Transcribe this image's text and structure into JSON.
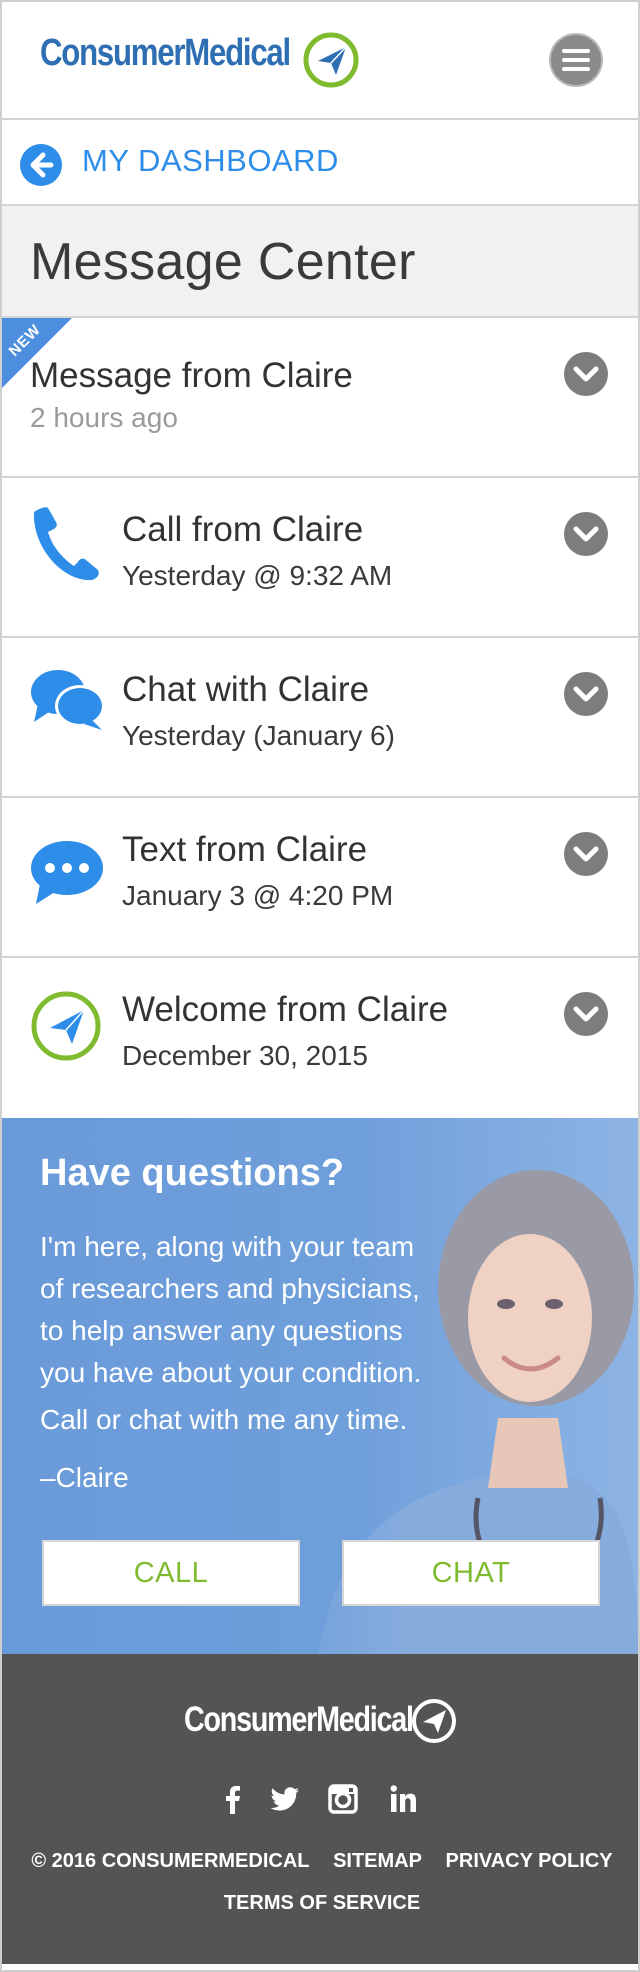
{
  "app": {
    "brand_name": "ConsumerMedical",
    "brand_tm": "™"
  },
  "nav": {
    "back_label": "MY DASHBOARD",
    "menu_icon": "hamburger-menu-icon"
  },
  "page": {
    "title": "Message Center"
  },
  "messages": [
    {
      "title": "Message from Claire",
      "subtitle": "2 hours ago",
      "badge": "NEW",
      "icon": "none"
    },
    {
      "title": "Call from Claire",
      "subtitle": "Yesterday @ 9:32 AM",
      "icon": "phone-icon"
    },
    {
      "title": "Chat with Claire",
      "subtitle": "Yesterday (January 6)",
      "icon": "chat-bubbles-icon"
    },
    {
      "title": "Text from Claire",
      "subtitle": "January 3 @ 4:20 PM",
      "icon": "text-bubble-icon"
    },
    {
      "title": "Welcome from Claire",
      "subtitle": "December 30, 2015",
      "icon": "consumermedical-logo-icon"
    }
  ],
  "promo": {
    "title": "Have questions?",
    "body": "I'm here, along with your team of researchers and physicians, to help answer any questions you have about your condition.",
    "body2": "Call or chat with me any time.",
    "signature": "–Claire",
    "call_label": "CALL",
    "chat_label": "CHAT"
  },
  "footer": {
    "brand_name": "ConsumerMedical",
    "social": [
      "facebook-icon",
      "twitter-icon",
      "instagram-icon",
      "linkedin-icon"
    ],
    "copyright": "© 2016 CONSUMERMEDICAL",
    "sitemap": "SITEMAP",
    "privacy": "PRIVACY POLICY",
    "terms": "TERMS OF SERVICE"
  },
  "colors": {
    "accent_blue": "#2d8de8",
    "brand_blue": "#2e6fb3",
    "brand_green": "#7fba2f",
    "promo_blue": "#6f9fdb",
    "footer_grey": "#545454"
  }
}
